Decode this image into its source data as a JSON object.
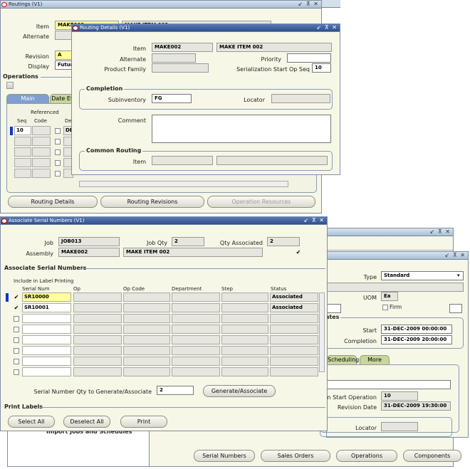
{
  "routings": {
    "title": "Routings (V1)",
    "item_label": "Item",
    "item_value": "MAKE002",
    "item_desc": "MAKE ITEM 002",
    "alternate_label": "Alternate",
    "revision_label": "Revision",
    "revision_value": "A",
    "display_label": "Display",
    "display_value": "Future",
    "operations_label": "Operations",
    "tab_main": "Main",
    "tab_date": "Date Ef",
    "referenced": "Referenced",
    "col_seq": "Seq",
    "col_code": "Code",
    "col_dept": "Dep",
    "row_seq": "10",
    "row_dept": "DE",
    "btn_routing_details": "Routing Details",
    "btn_routing_revisions": "Routing Revisions",
    "btn_operation_resources": "Operation Resources"
  },
  "routing_details": {
    "title": "Routing Details (V1)",
    "item_label": "Item",
    "item_value": "MAKE002",
    "item_desc": "MAKE ITEM 002",
    "alternate_label": "Alternate",
    "priority_label": "Priority",
    "product_family_label": "Product Family",
    "serialization_label": "Serialization Start Op Seq",
    "serialization_value": "10",
    "completion_label": "Completion",
    "subinventory_label": "Subinventory",
    "subinventory_value": "FG",
    "locator_label": "Locator",
    "comment_label": "Comment",
    "common_routing_label": "Common Routing",
    "common_item_label": "Item"
  },
  "discrete": {
    "type_label": "Type",
    "type_value": "Standard",
    "uom_label": "UOM",
    "uom_value": "Ea",
    "firm_label": "Firm",
    "dates_label": "ates",
    "start_label": "Start",
    "start_value": "31-DEC-2009 00:00:00",
    "completion_label": "Completion",
    "completion_value": "31-DEC-2009 20:00:00",
    "tab_scheduling": "Scheduling",
    "tab_more": "More",
    "op_start_label": "ation Start Operation",
    "op_start_value": "10",
    "revision_date_label": "Revision Date",
    "revision_date_value": "31-DEC-2009 19:30:00",
    "locator_label": "Locator",
    "btn_serial": "Serial Numbers",
    "btn_sales": "Sales Orders",
    "btn_operations": "Operations",
    "btn_components": "Components"
  },
  "navigator": {
    "partial_text": "Import Jobs and Schedules"
  },
  "assoc": {
    "title": "Associate Serial Numbers (V1)",
    "job_label": "Job",
    "job_value": "JOB013",
    "job_qty_label": "Job Qty",
    "job_qty_value": "2",
    "qty_assoc_label": "Qty Associated",
    "qty_assoc_value": "2",
    "assembly_label": "Assembly",
    "assembly_value": "MAKE002",
    "assembly_desc": "MAKE ITEM 002",
    "section_label": "Associate Serial Numbers",
    "include_label": "Include in Label Printing",
    "col_serial": "Serial Num",
    "col_op": "Op",
    "col_opcode": "Op Code",
    "col_dept": "Department",
    "col_step": "Step",
    "col_status": "Status",
    "rows": [
      {
        "serial": "SR10000",
        "status": "Associated",
        "checked": "✔"
      },
      {
        "serial": "SR10001",
        "status": "Associated",
        "checked": "✔"
      }
    ],
    "gen_label": "Serial Number Qty to Generate/Associate",
    "gen_value": "2",
    "btn_generate": "Generate/Associate",
    "print_labels": "Print Labels",
    "btn_select_all": "Select All",
    "btn_deselect_all": "Deselect All",
    "btn_print": "Print"
  },
  "window_controls": "↙ ⊼ ✕",
  "colors": {
    "accent": "#2e4f8f",
    "field_yellow": "#ffff9c",
    "canvas": "#f7f7e7"
  }
}
